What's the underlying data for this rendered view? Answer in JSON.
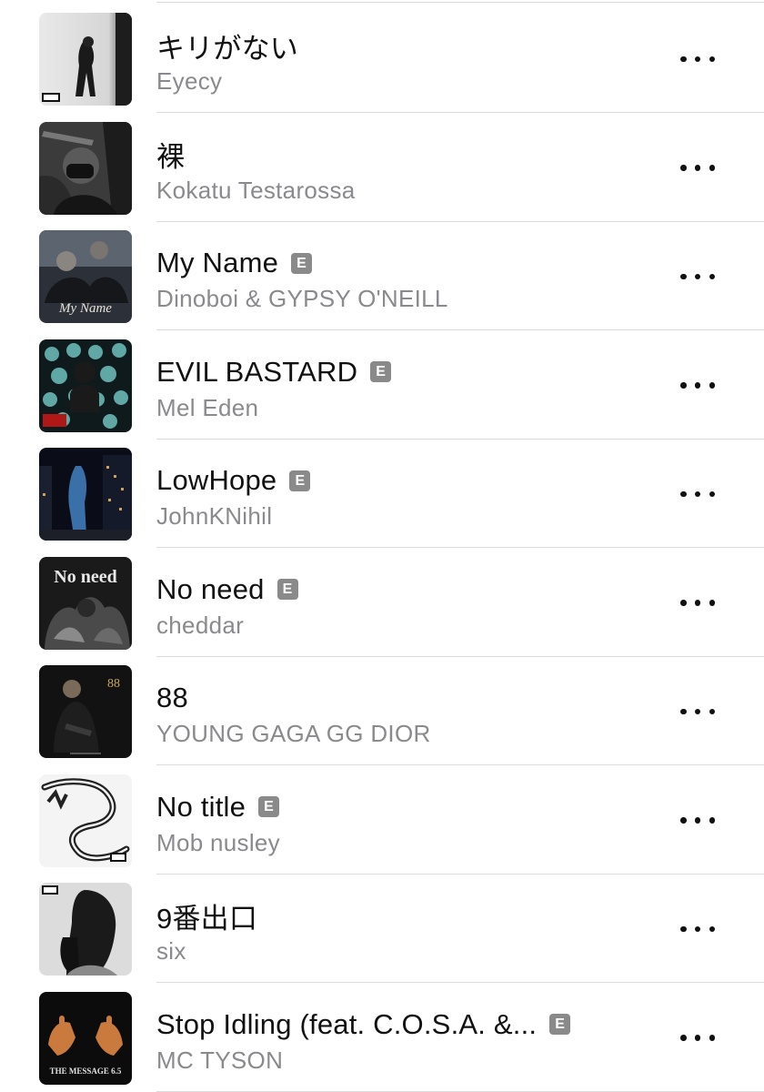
{
  "tracks": [
    {
      "title": "キリがない",
      "artist": "Eyecy",
      "explicit": false
    },
    {
      "title": "裸",
      "artist": "Kokatu Testarossa",
      "explicit": false
    },
    {
      "title": "My Name",
      "artist": "Dinoboi & GYPSY O'NEILL",
      "explicit": true,
      "art_text": "My Name"
    },
    {
      "title": "EVIL BASTARD",
      "artist": "Mel Eden",
      "explicit": true
    },
    {
      "title": "LowHope",
      "artist": "JohnKNihil",
      "explicit": true
    },
    {
      "title": "No need",
      "artist": "cheddar",
      "explicit": true,
      "art_text": "No need"
    },
    {
      "title": "88",
      "artist": "YOUNG GAGA GG DIOR",
      "explicit": false,
      "art_text": "88"
    },
    {
      "title": "No title",
      "artist": "Mob nusley",
      "explicit": true
    },
    {
      "title": "9番出口",
      "artist": "six",
      "explicit": false
    },
    {
      "title": "Stop Idling (feat. C.O.S.A. &...",
      "artist": "MC TYSON",
      "explicit": true,
      "art_text": "THE MESSAGE 6.5"
    }
  ],
  "explicit_label": "E",
  "more_icon": "ellipsis-icon",
  "colors": {
    "title": "#111111",
    "artist": "#8a8a8e",
    "divider": "#dcdcdc",
    "explicit_badge": "#8a8a8a"
  }
}
